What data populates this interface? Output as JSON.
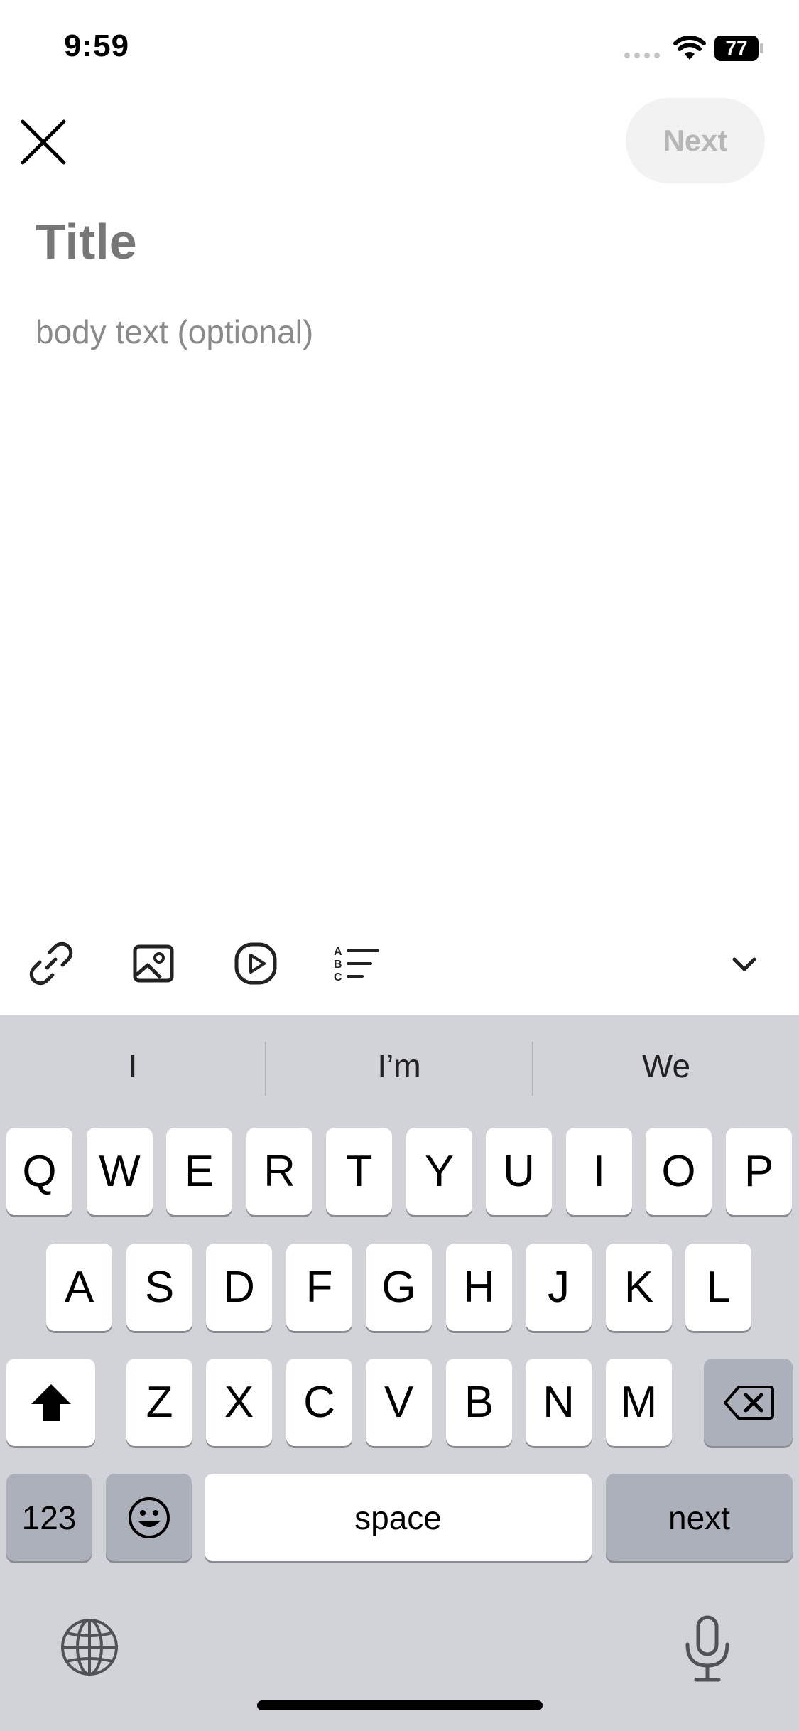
{
  "status_bar": {
    "time": "9:59",
    "battery": "77"
  },
  "header": {
    "next_label": "Next"
  },
  "editor": {
    "title_placeholder": "Title",
    "body_placeholder": "body text (optional)"
  },
  "keyboard": {
    "suggestions": [
      "I",
      "I’m",
      "We"
    ],
    "row1": [
      "Q",
      "W",
      "E",
      "R",
      "T",
      "Y",
      "U",
      "I",
      "O",
      "P"
    ],
    "row2": [
      "A",
      "S",
      "D",
      "F",
      "G",
      "H",
      "J",
      "K",
      "L"
    ],
    "row3": [
      "Z",
      "X",
      "C",
      "V",
      "B",
      "N",
      "M"
    ],
    "numbers_label": "123",
    "space_label": "space",
    "return_label": "next"
  },
  "icons": [
    "close-icon",
    "link-icon",
    "image-icon",
    "video-icon",
    "list-icon",
    "chevron-down-icon",
    "shift-icon",
    "backspace-icon",
    "emoji-icon",
    "globe-icon",
    "microphone-icon"
  ]
}
